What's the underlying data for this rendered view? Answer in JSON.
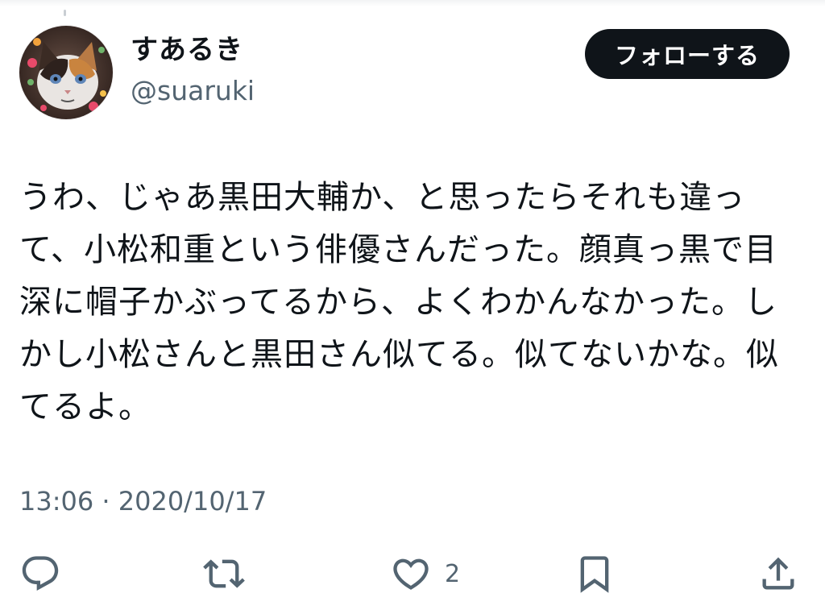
{
  "user": {
    "display_name": "すあるき",
    "handle": "@suaruki",
    "avatar_icon": "cat-avatar-icon"
  },
  "follow_button": {
    "label": "フォローする"
  },
  "tweet": {
    "text": "うわ、じゃあ黒田大輔か、と思ったらそれも違って、小松和重という俳優さんだった。顔真っ黒で目深に帽子かぶってるから、よくわかんなかった。しかし小松さんと黒田さん似てる。似てないかな。似てるよ。",
    "timestamp": "13:06 · 2020/10/17"
  },
  "actions": {
    "reply_icon": "reply-icon",
    "retweet_icon": "retweet-icon",
    "like_icon": "heart-icon",
    "like_count": "2",
    "bookmark_icon": "bookmark-icon",
    "share_icon": "share-icon"
  },
  "colors": {
    "text": "#0f1419",
    "secondary": "#536471",
    "button_bg": "#0f1419",
    "button_text": "#ffffff"
  }
}
